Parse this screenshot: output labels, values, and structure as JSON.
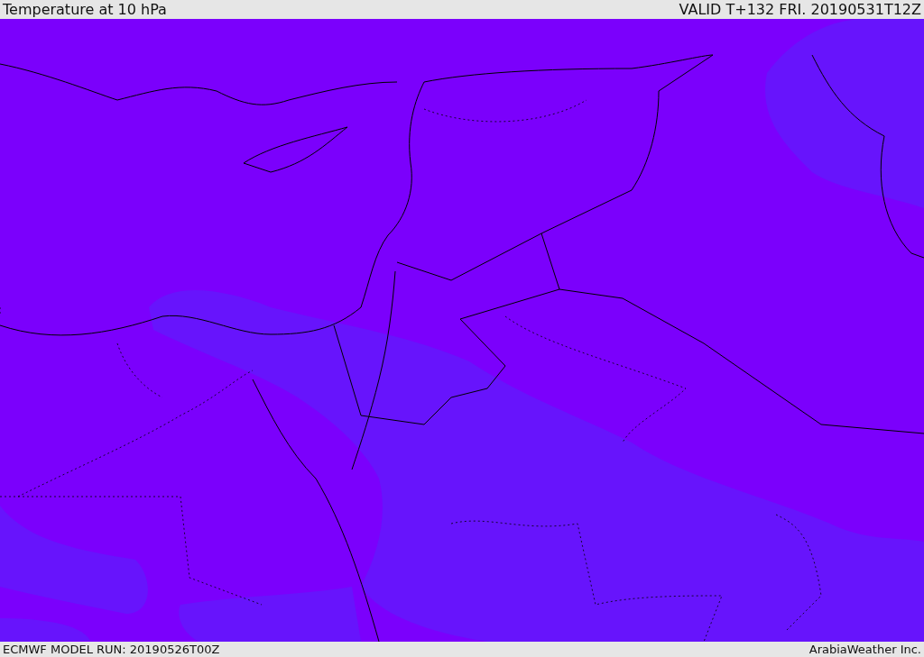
{
  "header": {
    "title": "Temperature at 10 hPa",
    "valid": "VALID T+132 FRI. 20190531T12Z"
  },
  "footer": {
    "model_run": "ECMWF MODEL RUN: 20190526T00Z",
    "credit": "ArabiaWeather Inc."
  }
}
